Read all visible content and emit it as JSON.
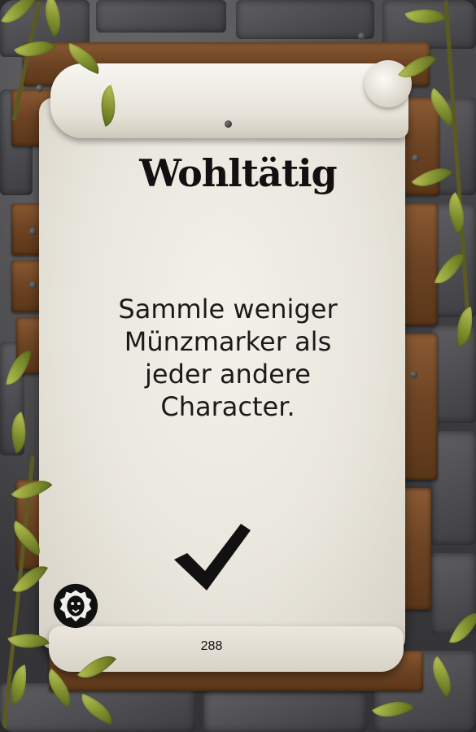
{
  "card": {
    "title": "Wohltätig",
    "text_lines": [
      "Sammle weniger",
      "Münzmarker als",
      "jeder andere",
      "Character."
    ],
    "number": "288",
    "icons": {
      "emblem": "lion-emblem-icon",
      "status": "checkmark-icon"
    },
    "colors": {
      "ink": "#111111",
      "parchment": "#ece9e0",
      "wood": "#6e4524",
      "leaf": "#8e9c34"
    }
  }
}
